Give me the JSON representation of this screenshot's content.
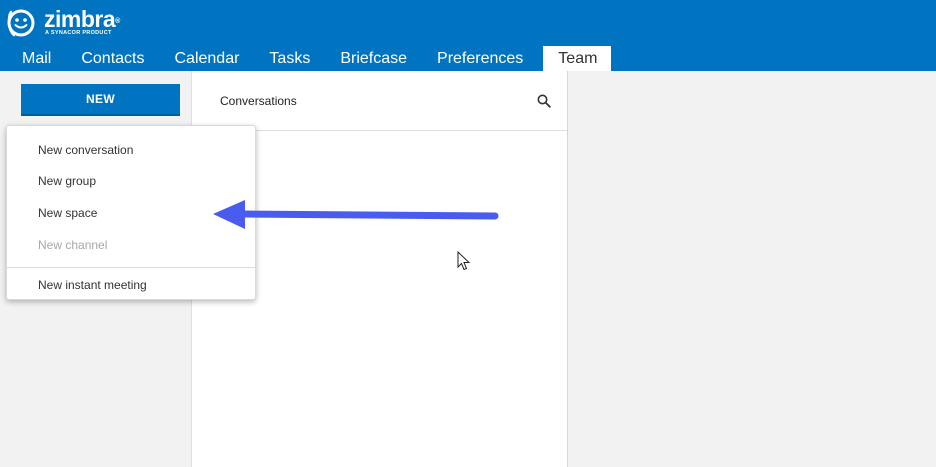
{
  "brand": {
    "name": "zimbra",
    "trademark": "®",
    "tagline": "A SYNACOR PRODUCT",
    "color": "#0074c1"
  },
  "nav": {
    "tabs": [
      {
        "label": "Mail"
      },
      {
        "label": "Contacts"
      },
      {
        "label": "Calendar"
      },
      {
        "label": "Tasks"
      },
      {
        "label": "Briefcase"
      },
      {
        "label": "Preferences"
      },
      {
        "label": "Team",
        "active": true
      }
    ]
  },
  "sidebar": {
    "new_button_label": "NEW"
  },
  "conversations": {
    "title": "Conversations",
    "search_icon": "search-icon"
  },
  "new_menu": {
    "items": [
      {
        "label": "New conversation",
        "enabled": true
      },
      {
        "label": "New group",
        "enabled": true
      },
      {
        "label": "New space",
        "enabled": true
      },
      {
        "label": "New channel",
        "enabled": false
      },
      {
        "label": "New instant meeting",
        "enabled": true
      }
    ]
  },
  "annotation": {
    "arrow_color": "#4a5cf0",
    "points_to": "New space"
  }
}
